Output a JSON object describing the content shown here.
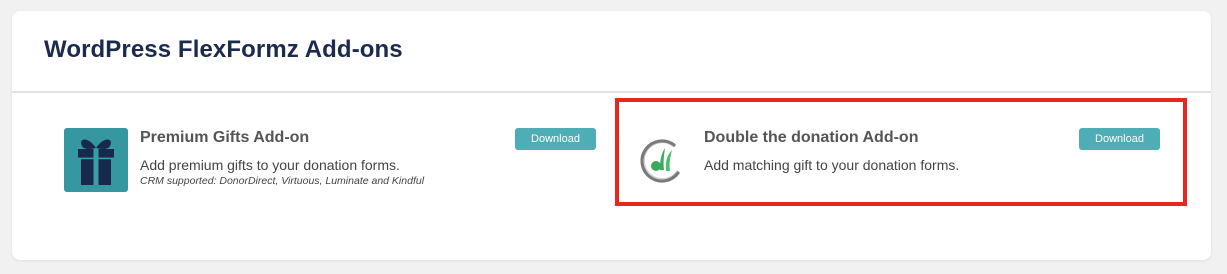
{
  "page": {
    "title": "WordPress FlexFormz Add-ons"
  },
  "addons": [
    {
      "title": "Premium Gifts Add-on",
      "description": "Add premium gifts to your donation forms.",
      "note": "CRM supported: DonorDirect, Virtuous, Luminate and Kindful",
      "button_label": "Download",
      "icon": "gift-box-icon"
    },
    {
      "title": "Double the donation Add-on",
      "description": "Add matching gift to your donation forms.",
      "button_label": "Download",
      "icon": "double-the-donation-logo-icon"
    }
  ],
  "colors": {
    "button": "#4eadb5",
    "title": "#1c2b4d",
    "highlight": "#e8271c",
    "gift_icon_bg": "#3a9ea6",
    "logo_green": "#3aaa5c"
  }
}
